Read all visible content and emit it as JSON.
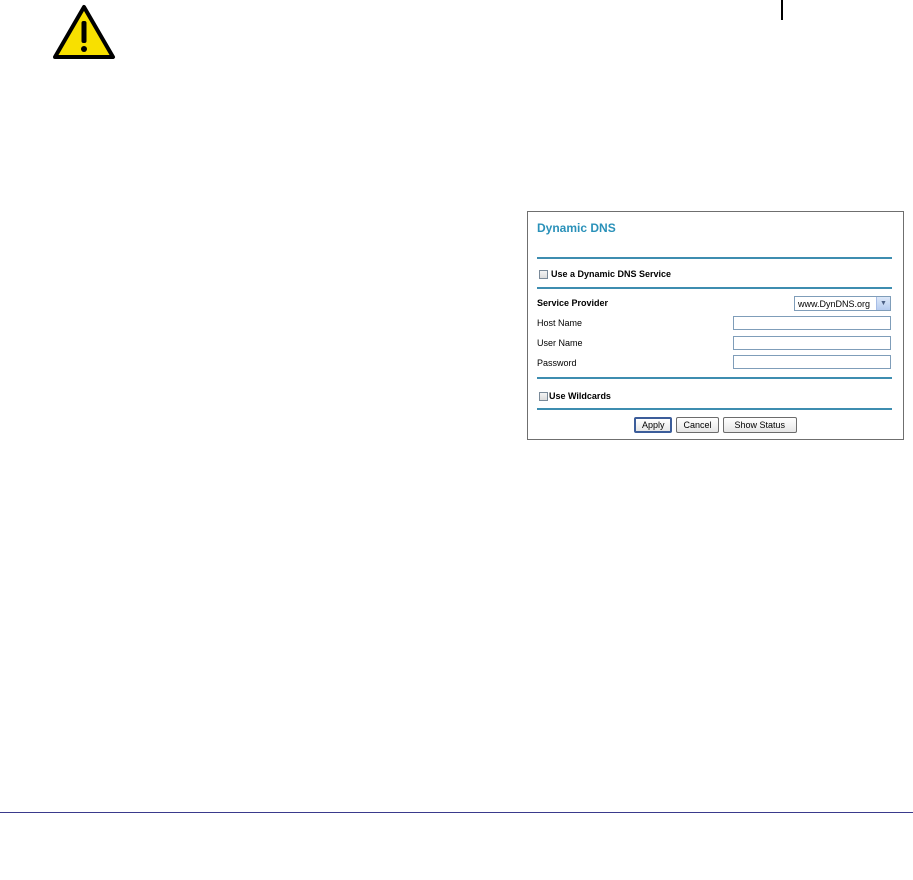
{
  "icons": {
    "warning": "warning-triangle-icon",
    "select_arrow": "chevron-down-icon"
  },
  "colors": {
    "title": "#2a91b9",
    "rule": "#3d8db0",
    "warning_fill": "#f8e000"
  },
  "dialog": {
    "title": "Dynamic DNS",
    "use_service_label": "Use a Dynamic DNS Service",
    "use_service_checked": false,
    "fields": {
      "service_provider_label": "Service Provider",
      "service_provider_value": "www.DynDNS.org",
      "host_name_label": "Host Name",
      "host_name_value": "",
      "user_name_label": "User Name",
      "user_name_value": "",
      "password_label": "Password",
      "password_value": ""
    },
    "use_wildcards_label": "Use Wildcards",
    "use_wildcards_checked": false,
    "buttons": {
      "apply": "Apply",
      "cancel": "Cancel",
      "show_status": "Show Status"
    }
  }
}
